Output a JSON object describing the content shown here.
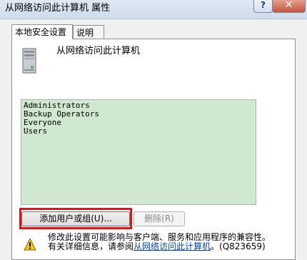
{
  "window": {
    "title": "从网络访问此计算机 属性",
    "help_glyph": "?",
    "close_glyph": "✕"
  },
  "tabs": [
    {
      "label": "本地安全设置"
    },
    {
      "label": "说明"
    }
  ],
  "policy": {
    "name": "从网络访问此计算机",
    "icon": "server-computer-icon"
  },
  "members": [
    "Administrators",
    "Backup Operators",
    "Everyone",
    "Users"
  ],
  "buttons": {
    "add": "添加用户或组(U)...",
    "remove": "删除(R)"
  },
  "note": {
    "line1": "修改此设置可能影响与客户端、服务和应用程序的兼容性。",
    "line2_prefix": "有关详细信息，请参阅",
    "line2_link": "从网络访问此计算机",
    "line2_suffix": "。(Q823659)",
    "icon": "warning-icon"
  },
  "colors": {
    "list_background": "#cfe8cf",
    "highlight_border": "#e01515",
    "link": "#0645ad"
  }
}
